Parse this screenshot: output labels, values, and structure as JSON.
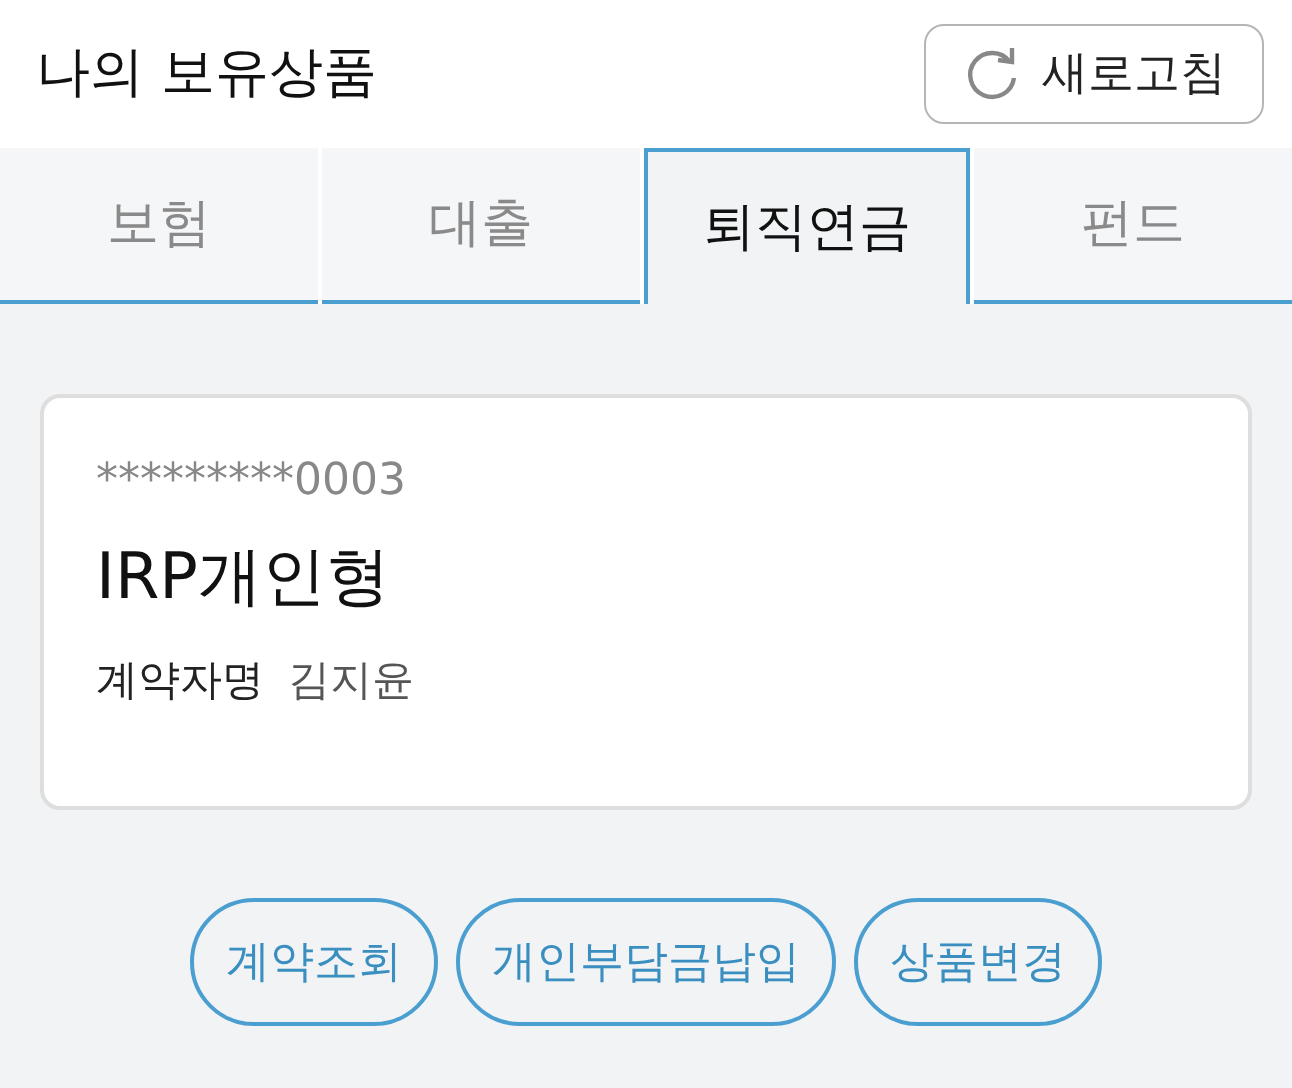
{
  "header": {
    "title": "나의 보유상품",
    "refresh_button": "새로고침"
  },
  "tabs": [
    {
      "label": "보험",
      "selected": false
    },
    {
      "label": "대출",
      "selected": false
    },
    {
      "label": "퇴직연금",
      "selected": true
    },
    {
      "label": "펀드",
      "selected": false
    }
  ],
  "card": {
    "account_number": "*********0003",
    "product_name": "IRP개인형",
    "holder_label": "계약자명",
    "holder_name": "김지윤"
  },
  "actions": [
    "계약조회",
    "개인부담금납입",
    "상품변경"
  ]
}
